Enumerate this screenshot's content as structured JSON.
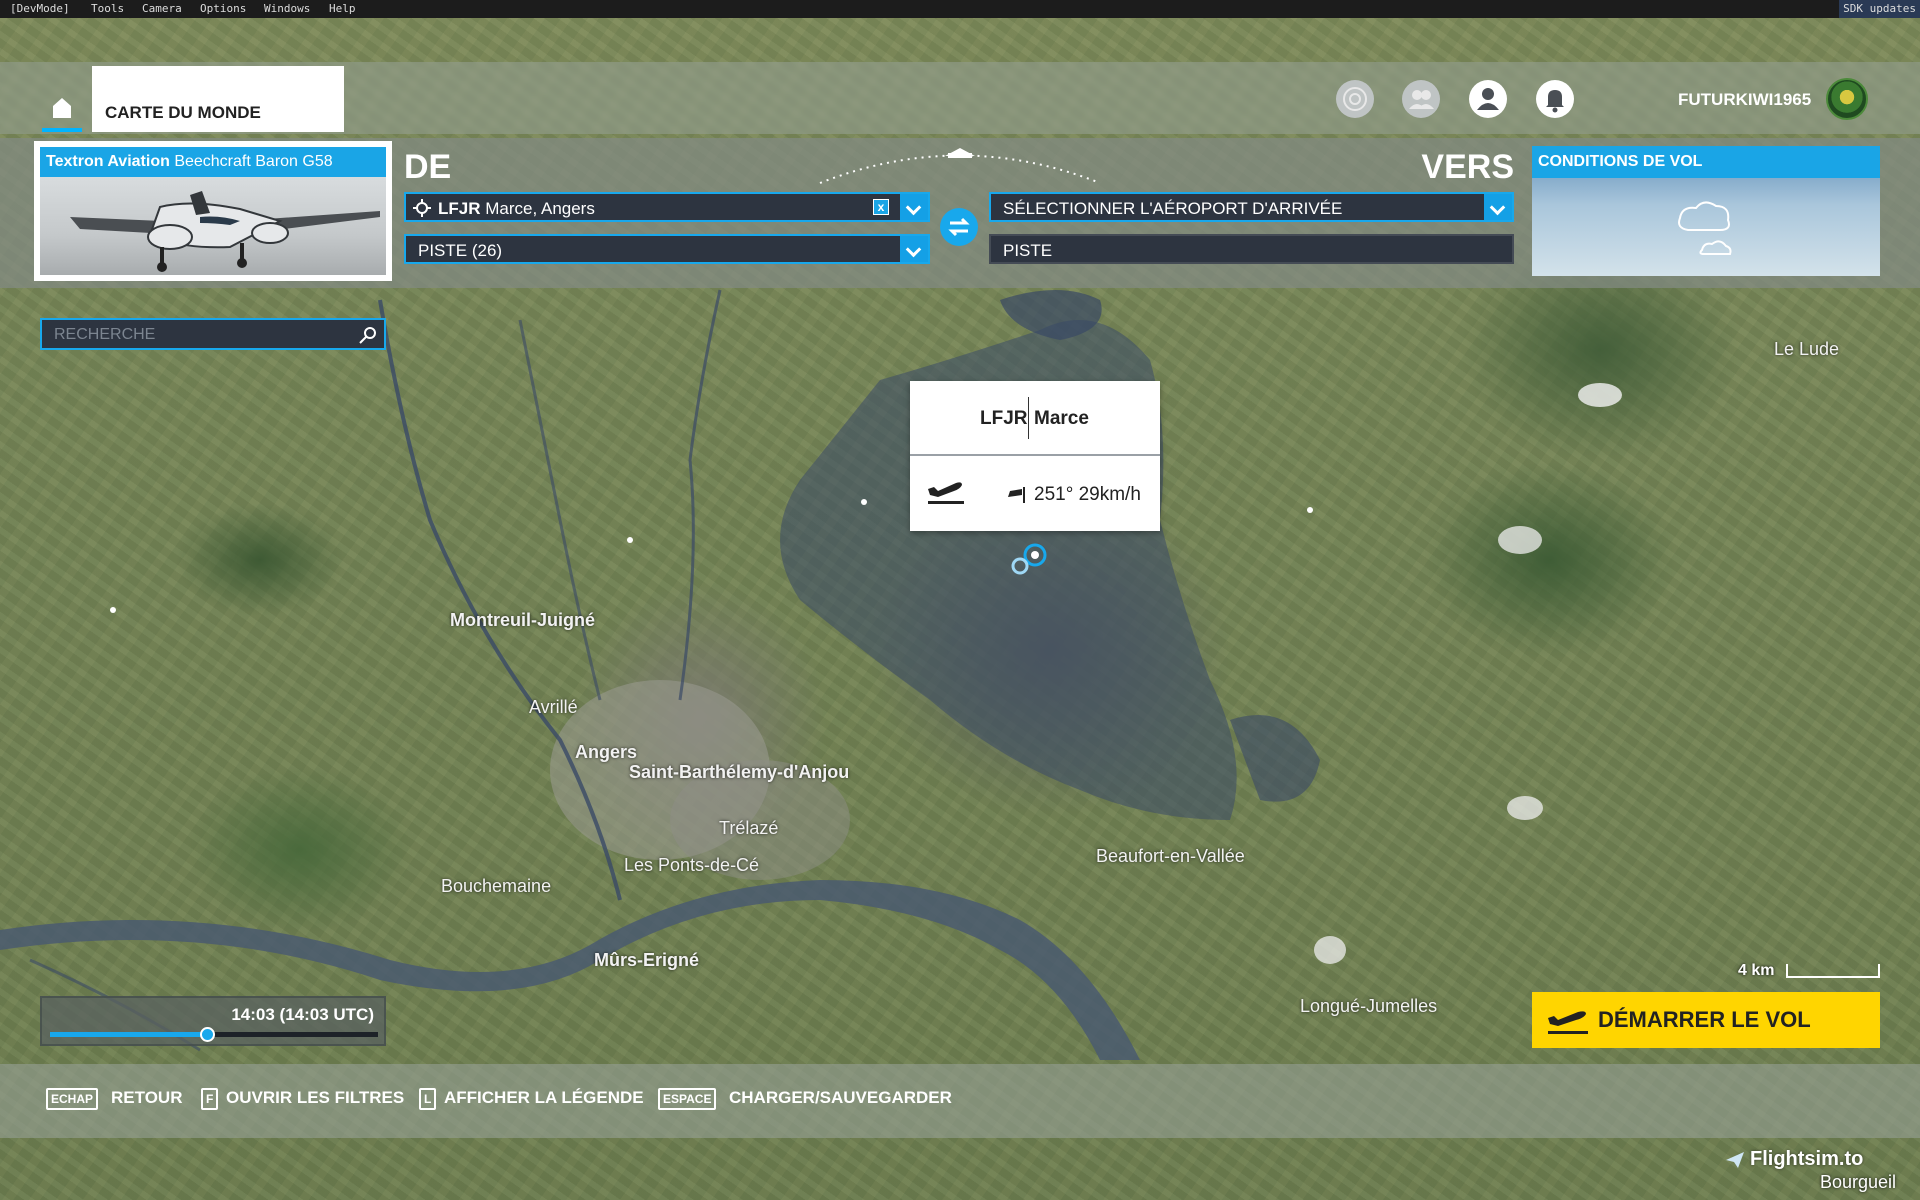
{
  "devbar": {
    "items": [
      "[DevMode]",
      "Tools",
      "Camera",
      "Options",
      "Windows",
      "Help"
    ],
    "sdk_updates": "SDK updates"
  },
  "header": {
    "tab_world": "CARTE DU MONDE",
    "username": "FUTURKIWI1965",
    "icons": [
      "achievements-icon",
      "friends-icon",
      "profile-icon",
      "notifications-icon"
    ]
  },
  "aircraft": {
    "maker": "Textron Aviation",
    "model": "Beechcraft Baron G58"
  },
  "departure": {
    "heading": "DE",
    "icao": "LFJR",
    "name": "Marce, Angers",
    "runway": "PISTE (26)",
    "clear_label": "x"
  },
  "arrival": {
    "heading": "VERS",
    "placeholder": "SÉLECTIONNER L'AÉROPORT D'ARRIVÉE",
    "runway": "PISTE"
  },
  "weather": {
    "title": "CONDITIONS DE VOL"
  },
  "search": {
    "placeholder": "RECHERCHE"
  },
  "popup": {
    "icao": "LFJR",
    "name": "Marce",
    "wind": "251° 29km/h"
  },
  "map": {
    "towns": [
      {
        "label": "Le Lude",
        "bold": false
      },
      {
        "label": "Montreuil-Juigné",
        "bold": true
      },
      {
        "label": "Avrillé",
        "bold": false
      },
      {
        "label": "Angers",
        "bold": true
      },
      {
        "label": "Saint-Barthélemy-d'Anjou",
        "bold": true
      },
      {
        "label": "Trélazé",
        "bold": false
      },
      {
        "label": "Les Ponts-de-Cé",
        "bold": false
      },
      {
        "label": "Bouchemaine",
        "bold": false
      },
      {
        "label": "Beaufort-en-Vallée",
        "bold": false
      },
      {
        "label": "Mûrs-Erigné",
        "bold": true
      },
      {
        "label": "Longué-Jumelles",
        "bold": false
      },
      {
        "label": "Bourgueil",
        "bold": false
      }
    ],
    "scale_label": "4 km"
  },
  "time": {
    "label": "14:03 (14:03 UTC)",
    "progress": 0.48
  },
  "start_button": {
    "label": "DÉMARRER LE VOL"
  },
  "bottom_hints": [
    {
      "key": "ECHAP",
      "label": "RETOUR"
    },
    {
      "key": "F",
      "label": "OUVRIR LES FILTRES"
    },
    {
      "key": "L",
      "label": "AFFICHER LA LÉGENDE"
    },
    {
      "key": "ESPACE",
      "label": "CHARGER/SAUVEGARDER"
    }
  ],
  "watermark": "Flightsim.to",
  "colors": {
    "accent_blue": "#18a8ec",
    "start_yellow": "#ffd500",
    "field_bg": "#2d3440"
  }
}
